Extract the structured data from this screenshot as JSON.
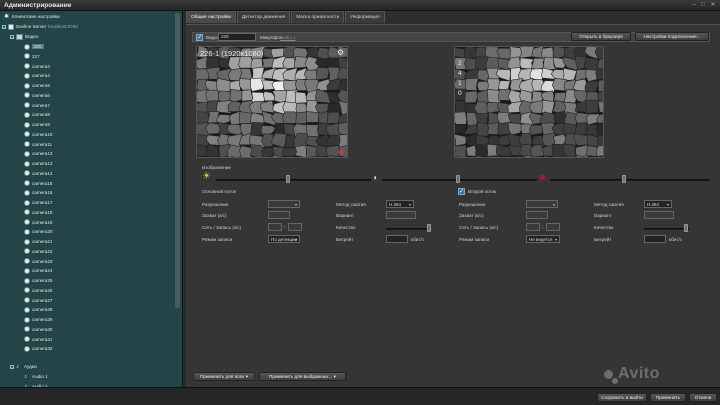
{
  "window": {
    "title": "Администрирование"
  },
  "sidebar": {
    "client_settings": "Клиентские настройки",
    "server": {
      "name": "Devline Server",
      "host": "localhost:9780"
    },
    "video": "Видео",
    "cameras": [
      "226",
      "227",
      "camera3",
      "camera4",
      "camera5",
      "camera6",
      "camera7",
      "camera8",
      "camera9",
      "camera10",
      "camera11",
      "camera12",
      "camera13",
      "camera14",
      "camera15",
      "camera16",
      "camera17",
      "camera18",
      "camera19",
      "camera20",
      "camera21",
      "camera22",
      "camera23",
      "camera24",
      "camera25",
      "camera26",
      "camera27",
      "camera28",
      "camera29",
      "camera30",
      "camera31",
      "camera32"
    ],
    "selected_index": 0,
    "audio": "Аудио",
    "audio_items": [
      "Audio 1",
      "Audio 2"
    ]
  },
  "tabs": [
    {
      "label": "Общие настройки",
      "active": true
    },
    {
      "label": "Детектор движения",
      "active": false
    },
    {
      "label": "Маска приватности",
      "active": false
    },
    {
      "label": "Информация",
      "active": false
    }
  ],
  "camera_bar": {
    "enabled_label": "Видео",
    "camera_name": "226",
    "microphone_label": "Микрофон",
    "microphone_value": "Audio 1",
    "open_browser": "Открыть в браузере",
    "connection_settings": "Настройки подключения..."
  },
  "preview": {
    "overlay": "226-1 (1920x1080)",
    "secondary_overlay": [
      "2",
      "4",
      "1",
      "0"
    ]
  },
  "image_section": {
    "label": "Изображение"
  },
  "main_stream": {
    "label": "Основной поток",
    "resolution_label": "Разрешение",
    "capture_label": "Захват (к/с)",
    "network_record_label": "Сеть / Запись (к/с)",
    "record_mode_label": "Режим записи",
    "record_mode_value": "По детекции",
    "compression_label": "Метод сжатия",
    "compression_value": "H.264",
    "variant_label": "Вариант",
    "quality_label": "Качество",
    "bitrate_label": "Битрейт",
    "bitrate_unit": "кбит/с"
  },
  "second_stream": {
    "enabled": true,
    "label": "Второй поток",
    "resolution_label": "Разрешение",
    "capture_label": "Захват (к/с)",
    "network_record_label": "Сеть / Запись (к/с)",
    "record_mode_label": "Режим записи",
    "record_mode_value": "Не ведется",
    "compression_label": "Метод сжатия",
    "compression_value": "H.264",
    "variant_label": "Вариант",
    "quality_label": "Качество",
    "bitrate_label": "Битрейт",
    "bitrate_unit": "кбит/с"
  },
  "bottom_buttons": {
    "apply_all": "Применить для всех",
    "apply_selected": "Применить для выбранных..."
  },
  "footer": {
    "save_exit": "Сохранить и выйти",
    "apply": "Применить",
    "cancel": "Отмена"
  },
  "watermark": "Avito",
  "colors": {
    "sidebar_bg": "#234547",
    "accent": "#3a6fa8",
    "panel_bg": "#353535"
  }
}
